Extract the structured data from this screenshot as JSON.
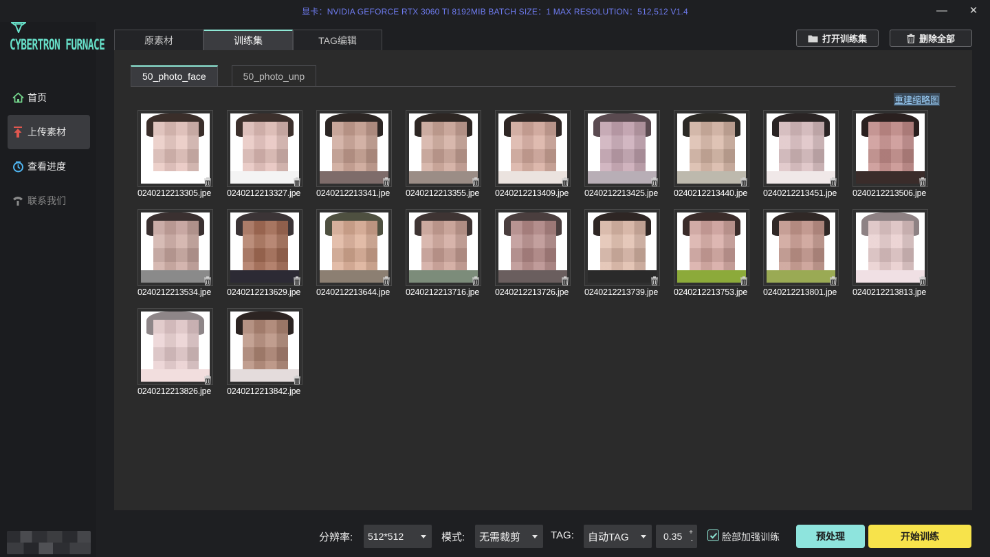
{
  "titlebar": {
    "info": "显卡：NVIDIA GEFORCE RTX 3060 TI 8192MIB  BATCH SIZE：1  MAX RESOLUTION：512,512 V1.4",
    "minimize": "—",
    "close": "✕"
  },
  "logo": {
    "text": "CYBERTRON FURNACE"
  },
  "sidebar": {
    "items": [
      {
        "label": "首页",
        "icon": "home-icon",
        "state": "normal"
      },
      {
        "label": "上传素材",
        "icon": "upload-icon",
        "state": "active"
      },
      {
        "label": "查看进度",
        "icon": "progress-icon",
        "state": "normal"
      },
      {
        "label": "联系我们",
        "icon": "contact-icon",
        "state": "disabled"
      }
    ]
  },
  "tabs": [
    {
      "label": "原素材",
      "active": false
    },
    {
      "label": "训练集",
      "active": true
    },
    {
      "label": "TAG编辑",
      "active": false
    }
  ],
  "toolbar": {
    "open_label": "打开训练集",
    "delete_all_label": "删除全部"
  },
  "subtabs": [
    {
      "label": "50_photo_face",
      "active": true
    },
    {
      "label": "50_photo_unp",
      "active": false
    }
  ],
  "rebuild_label": "重建缩略图",
  "thumbnails": [
    {
      "name": "0240212213305.jpe",
      "hair": "#3a2e2a",
      "face": "#e8c6bf",
      "shirt": "#ffffff"
    },
    {
      "name": "0240212213327.jpe",
      "hair": "#3c302c",
      "face": "#e6c2bc",
      "shirt": "#f4f4f4"
    },
    {
      "name": "0240212213341.jpe",
      "hair": "#2c2624",
      "face": "#caa293",
      "shirt": "#7e6c6a"
    },
    {
      "name": "0240212213355.jpe",
      "hair": "#2d2623",
      "face": "#d0a99c",
      "shirt": "#9b8d86"
    },
    {
      "name": "0240212213409.jpe",
      "hair": "#2f2725",
      "face": "#d8ada0",
      "shirt": "#ebe3df"
    },
    {
      "name": "0240212213425.jpe",
      "hair": "#5a4a50",
      "face": "#c9a8b5",
      "shirt": "#b8aeb6"
    },
    {
      "name": "0240212213440.jpe",
      "hair": "#2c2a26",
      "face": "#d8b7a6",
      "shirt": "#bdb9ad"
    },
    {
      "name": "0240212213451.jpe",
      "hair": "#2a2424",
      "face": "#dcc0c2",
      "shirt": "#f0e8e8"
    },
    {
      "name": "0240212213506.jpe",
      "hair": "#2a201f",
      "face": "#c78f8c",
      "shirt": "#3a2c2a"
    },
    {
      "name": "0240212213534.jpe",
      "hair": "#3a3030",
      "face": "#cdaaa3",
      "shirt": "#8a8a8a"
    },
    {
      "name": "0240212213629.jpe",
      "hair": "#3b3436",
      "face": "#a97058",
      "shirt": "#2c2a34"
    },
    {
      "name": "0240212213644.jpe",
      "hair": "#4e5040",
      "face": "#dcae96",
      "shirt": "#8c7f72"
    },
    {
      "name": "0240212213716.jpe",
      "hair": "#3e3433",
      "face": "#cfa59a",
      "shirt": "#7c8c7a"
    },
    {
      "name": "0240212213726.jpe",
      "hair": "#4a3e3e",
      "face": "#b78c8a",
      "shirt": "#6a5e5e"
    },
    {
      "name": "0240212213739.jpe",
      "hair": "#2e2624",
      "face": "#e0bcab",
      "shirt": "#2a2a2a"
    },
    {
      "name": "0240212213753.jpe",
      "hair": "#3a2c2a",
      "face": "#d6a8a2",
      "shirt": "#8caa3a"
    },
    {
      "name": "0240212213801.jpe",
      "hair": "#302826",
      "face": "#c89a8f",
      "shirt": "#9aaa54"
    },
    {
      "name": "0240212213813.jpe",
      "hair": "#8e8284",
      "face": "#e8cccc",
      "shirt": "#f0e0e4"
    },
    {
      "name": "0240212213826.jpe",
      "hair": "#8e8688",
      "face": "#eacfd0",
      "shirt": "#f2dede"
    },
    {
      "name": "0240212213842.jpe",
      "hair": "#2c2422",
      "face": "#b48a78",
      "shirt": "#e4dcdc"
    }
  ],
  "controls": {
    "resolution_label": "分辨率:",
    "resolution_value": "512*512",
    "mode_label": "模式:",
    "mode_value": "无需裁剪",
    "tag_label": "TAG:",
    "tag_value": "自动TAG",
    "threshold_value": "0.35",
    "face_enhance_label": "脸部加强训练",
    "face_enhance_checked": true,
    "preprocess_label": "预处理",
    "start_label": "开始训练"
  },
  "colors": {
    "accent": "#8fe8d6",
    "title_info": "#6f7cf2",
    "preprocess_btn": "#8ee4dd",
    "start_btn": "#f7e34b"
  }
}
